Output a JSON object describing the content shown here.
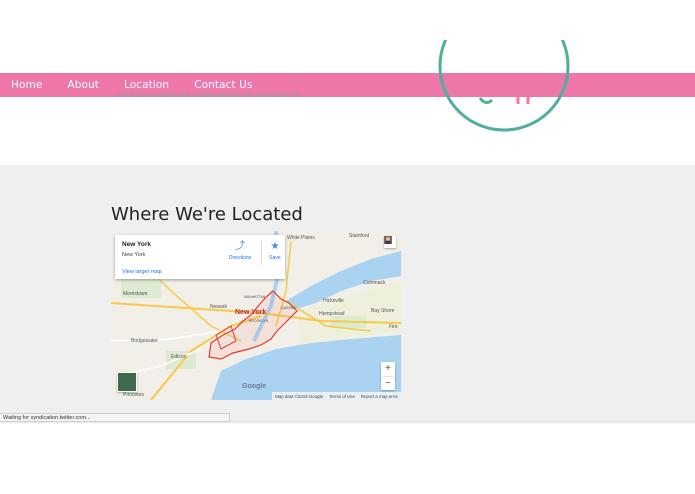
{
  "nav": {
    "items": [
      "Home",
      "About",
      "Location",
      "Contact Us"
    ]
  },
  "header": {
    "clipped_text": "...lorem ipsum tagline text clipped beneath the navigation bar..."
  },
  "section": {
    "title": "Where We're Located"
  },
  "map": {
    "place_title": "New York",
    "place_subtitle": "New York",
    "larger_map_link": "View larger map",
    "directions_label": "Directions",
    "save_label": "Save",
    "zoom_in": "+",
    "zoom_out": "−",
    "google_logo": "Google",
    "attribution": [
      "Map data ©2018 Google",
      "Terms of Use",
      "Report a map error"
    ],
    "labels": [
      "White Plains",
      "Stamford",
      "Morristown",
      "Newark",
      "New York",
      "Hicksville",
      "Hempstead",
      "Commack",
      "Bay Shore",
      "Bridgewater",
      "Edison",
      "Princeton",
      "Fire",
      "MANHATTAN",
      "QUEENS",
      "BROOKLYN"
    ],
    "colors": {
      "water": "#a9d3f1",
      "boundary": "#e03c31",
      "land": "#f2efe9"
    }
  },
  "status_bar": {
    "text": "Waiting for syndication.twitter.com..."
  },
  "colors": {
    "nav_bg": "#ee76a9",
    "section_bg": "#efefef",
    "logo_ring": "#4fae9c"
  }
}
